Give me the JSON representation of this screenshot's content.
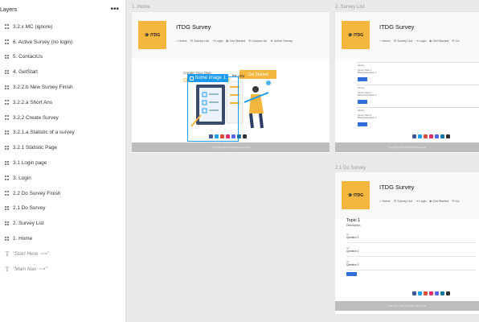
{
  "layers": {
    "title": "Layers",
    "more": "•••",
    "items": [
      {
        "label": "3.2.x MC (ignore)",
        "type": "frame"
      },
      {
        "label": "6. Active Survey (no login)",
        "type": "frame"
      },
      {
        "label": "5. ContactUs",
        "type": "frame"
      },
      {
        "label": "4. GetStart",
        "type": "frame"
      },
      {
        "label": "3.2.2.b New Survey Finish",
        "type": "frame"
      },
      {
        "label": "3.2.2.a Short Ans",
        "type": "frame"
      },
      {
        "label": "3.2.2 Create Survey",
        "type": "frame"
      },
      {
        "label": "3.2.1.a Statistic of a survey",
        "type": "frame"
      },
      {
        "label": "3.2.1 Statistic Page",
        "type": "frame"
      },
      {
        "label": "3.1 Login page",
        "type": "frame"
      },
      {
        "label": "3. Login",
        "type": "frame"
      },
      {
        "label": "2.2 Do Survey Finish",
        "type": "frame"
      },
      {
        "label": "2.1 Do Survey",
        "type": "frame"
      },
      {
        "label": "2. Survey List",
        "type": "frame"
      },
      {
        "label": "1. Home",
        "type": "frame"
      },
      {
        "label": "\"Start Here ⟶\"",
        "type": "text"
      },
      {
        "label": "\"Main Nav ⟶\"",
        "type": "text"
      }
    ]
  },
  "frames": {
    "home": {
      "label": "1. Home"
    },
    "survey_list": {
      "label": "2. Survey List"
    },
    "do_survey": {
      "label": "2.1 Do Survey"
    }
  },
  "site": {
    "logo_text": "ITDG",
    "title": "ITDG Survey",
    "nav": [
      "Home",
      "Survey List",
      "Login",
      "Get Started",
      "Contact Us",
      "Active Survey"
    ],
    "nav_short": [
      "Home",
      "Survey List",
      "Login",
      "Get Started",
      "Co"
    ],
    "footer": "Copyright 2021 All Rights Reserved"
  },
  "home": {
    "create_text": "Create Your Own",
    "online_text": "ONLINE SURVEY",
    "cta_label": "Get Started",
    "for_you": "for you",
    "selection_tag": "home image 1"
  },
  "survey_list": {
    "items": [
      {
        "title": "Survey",
        "lines": [
          "Survey Topic 1",
          "Brown Description 1"
        ]
      },
      {
        "title": "Survey",
        "lines": [
          "Survey Topic 2",
          "Brown Description 2"
        ]
      },
      {
        "title": "Survey",
        "lines": [
          "Survey Topic 3",
          "Brown Description 3"
        ]
      }
    ]
  },
  "do_survey": {
    "topic": "Topic 1",
    "description": "Description",
    "questions": [
      {
        "hint": "Q1",
        "label": "Question 1"
      },
      {
        "hint": "Q2",
        "label": "Question 2"
      },
      {
        "hint": "Q3",
        "label": "Question 3"
      }
    ]
  },
  "colors": {
    "accent": "#f4b63e",
    "selection": "#1a9bf0",
    "primary_button": "#2f6fdb",
    "footer": "#bdbdbd",
    "social": [
      "#3b5998",
      "#1da1f2",
      "#dd4b39",
      "#e1306c",
      "#5865f2",
      "#0e76a8",
      "#333333"
    ]
  }
}
